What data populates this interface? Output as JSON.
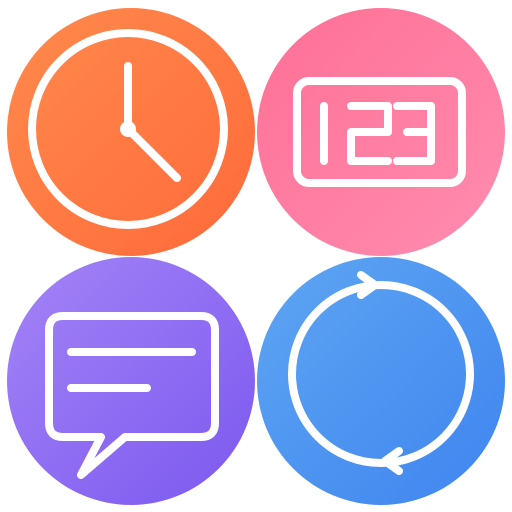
{
  "icons": [
    {
      "name": "clock-icon",
      "gradient": [
        "#ff8a4c",
        "#ff6a3a"
      ]
    },
    {
      "name": "number-counter-icon",
      "display_text": "123",
      "gradient": [
        "#ff6f95",
        "#ff8db0"
      ]
    },
    {
      "name": "message-bubble-icon",
      "gradient": [
        "#a484f7",
        "#7b58ef"
      ]
    },
    {
      "name": "sync-refresh-icon",
      "gradient": [
        "#5ea6f3",
        "#3f84ef"
      ]
    }
  ],
  "colors": {
    "glyph": "#ffffff",
    "background": "#ffffff"
  }
}
